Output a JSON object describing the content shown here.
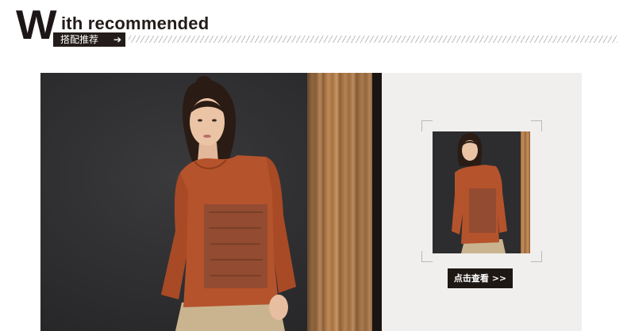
{
  "header": {
    "big_letter": "W",
    "title": "ith recommended",
    "subtitle": "搭配推荐",
    "arrow": "➔"
  },
  "main_photo": {
    "description_icon": "model-photo"
  },
  "side_panel": {
    "view_button_label": "点击查看 >>"
  },
  "colors": {
    "brand_dark": "#231c1a",
    "panel_bg": "#f0efee",
    "top_rust": "#b5532c",
    "pants_khaki": "#c9b48f",
    "backdrop": "#2e2e30"
  }
}
